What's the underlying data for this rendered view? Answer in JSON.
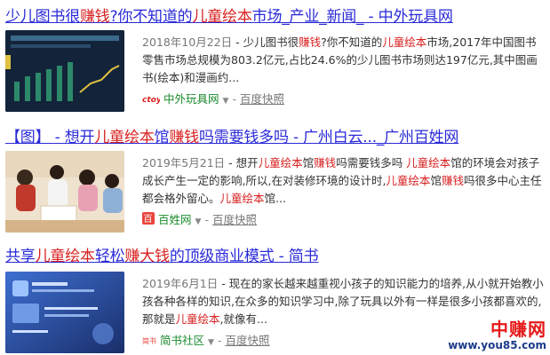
{
  "results": [
    {
      "title_parts": [
        {
          "t": "少儿图书很",
          "h": false
        },
        {
          "t": "赚钱",
          "h": true
        },
        {
          "t": "?你不知道的",
          "h": false
        },
        {
          "t": "儿童绘本",
          "h": true
        },
        {
          "t": "市场_产业_新闻_ - 中外玩具网",
          "h": false
        }
      ],
      "date": "2018年10月22日",
      "snippet_parts": [
        {
          "t": " - 少儿图书很",
          "h": false
        },
        {
          "t": "赚钱",
          "h": true
        },
        {
          "t": "?你不知道的",
          "h": false
        },
        {
          "t": "儿童绘本",
          "h": true
        },
        {
          "t": "市场,2017年中国图书零售市场总规模为803.2亿元,占比24.6%的少儿图书市场则达197亿元,其中图画书(绘本)和漫画约...",
          "h": false
        }
      ],
      "source": "中外玩具网",
      "snapshot": "百度快照",
      "thumb_icon": "chart-thumbnail-icon",
      "logo_text": "ctoy"
    },
    {
      "title_parts": [
        {
          "t": "【图】 - 想开",
          "h": false
        },
        {
          "t": "儿童绘本",
          "h": true
        },
        {
          "t": "馆",
          "h": false
        },
        {
          "t": "赚钱",
          "h": true
        },
        {
          "t": "吗需要钱多吗 - 广州白云..._广州百姓网",
          "h": false
        }
      ],
      "date": "2019年5月21日",
      "snippet_parts": [
        {
          "t": " - 想开",
          "h": false
        },
        {
          "t": "儿童绘本",
          "h": true
        },
        {
          "t": "馆",
          "h": false
        },
        {
          "t": "赚钱",
          "h": true
        },
        {
          "t": "吗需要钱多吗 ",
          "h": false
        },
        {
          "t": "儿童绘本",
          "h": true
        },
        {
          "t": "馆的环境会对孩子成长产生一定的影响,所以,在对装修环境的设计时,",
          "h": false
        },
        {
          "t": "儿童绘本",
          "h": true
        },
        {
          "t": "馆",
          "h": false
        },
        {
          "t": "赚钱",
          "h": true
        },
        {
          "t": "吗很多中心主任都会格外留心。",
          "h": false
        },
        {
          "t": "儿童绘本",
          "h": true
        },
        {
          "t": "馆...",
          "h": false
        }
      ],
      "source": "百姓网",
      "snapshot": "百度快照",
      "thumb_icon": "children-reading-photo-icon",
      "logo_text": "百"
    },
    {
      "title_parts": [
        {
          "t": "共享",
          "h": false
        },
        {
          "t": "儿童绘本",
          "h": true
        },
        {
          "t": "轻松",
          "h": false
        },
        {
          "t": "赚大钱",
          "h": true
        },
        {
          "t": "的顶级商业模式 - 简书",
          "h": false
        }
      ],
      "date": "2019年6月1日",
      "snippet_parts": [
        {
          "t": " - 现在的家长越来越重视小孩子的知识能力的培养,从小就开始教小孩各种各样的知识,在众多的知识学习中,除了玩具以外有一样是很多小孩都喜欢的,那就是",
          "h": false
        },
        {
          "t": "儿童绘本",
          "h": true
        },
        {
          "t": ",就像有...",
          "h": false
        }
      ],
      "source": "简书社区",
      "snapshot": "百度快照",
      "thumb_icon": "membership-card-icon",
      "logo_text": "简书"
    }
  ],
  "watermark": {
    "cn": "中赚网",
    "en": "www.you85.com"
  },
  "colors": {
    "title": "#2a2ad8",
    "highlight": "#d81f1f",
    "source": "#1a8a2c",
    "text": "#333333"
  }
}
